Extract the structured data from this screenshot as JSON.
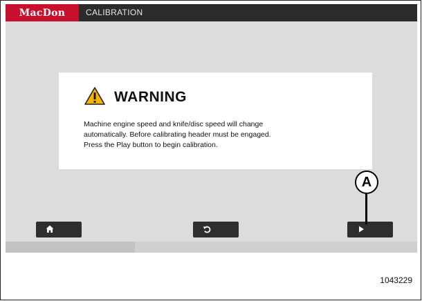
{
  "header": {
    "logo_text": "MacDon",
    "title": "CALIBRATION"
  },
  "dialog": {
    "title": "WARNING",
    "body_lines": [
      "Machine engine speed and knife/disc speed will change",
      "automatically. Before calibrating header must be engaged.",
      "Press the Play button to begin calibration."
    ]
  },
  "footer_buttons": [
    {
      "icon": "home-icon"
    },
    {
      "icon": "back-arrow-icon"
    },
    {
      "icon": "play-icon"
    }
  ],
  "callout": {
    "label": "A"
  },
  "figure_number": "1043229",
  "colors": {
    "brand_red": "#c8102e",
    "topbar": "#2b2b2b",
    "screen_bg": "#dcdcdc",
    "button": "#2e2e2e",
    "warning_yellow": "#f5b400"
  }
}
